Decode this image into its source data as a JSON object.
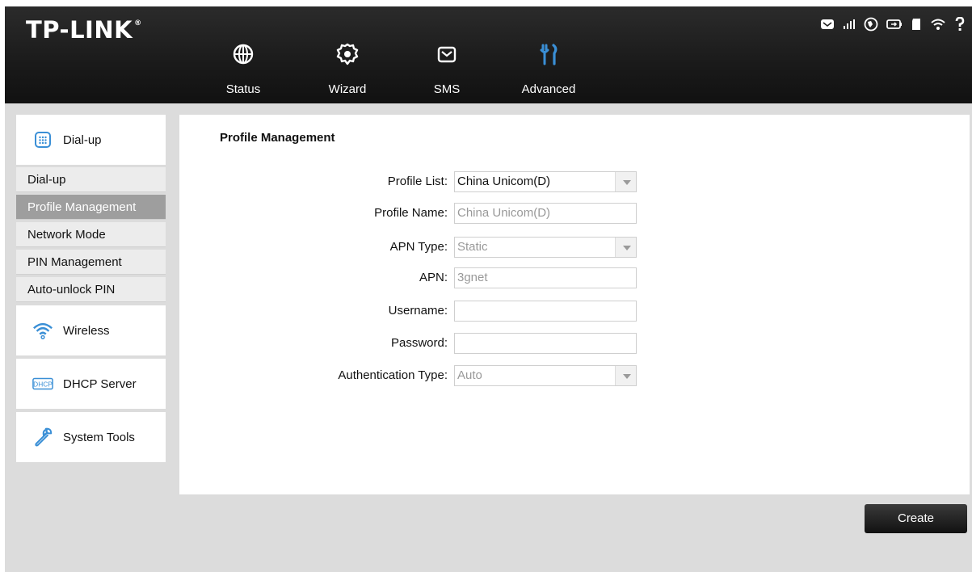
{
  "header": {
    "logo": "TP-LINK",
    "logo_mark": "®",
    "nav": [
      {
        "label": "Status",
        "icon": "globe-icon"
      },
      {
        "label": "Wizard",
        "icon": "gear-icon"
      },
      {
        "label": "SMS",
        "icon": "envelope-icon"
      },
      {
        "label": "Advanced",
        "icon": "tools-icon",
        "active": true
      }
    ],
    "status_icons": [
      "message-icon",
      "signal-icon",
      "internet-icon",
      "battery-icon",
      "sd-card-icon",
      "wifi-icon",
      "help-icon"
    ]
  },
  "sidebar": {
    "groups": [
      {
        "label": "Dial-up",
        "icon": "dialpad-icon",
        "items": [
          {
            "label": "Dial-up"
          },
          {
            "label": "Profile Management",
            "active": true
          },
          {
            "label": "Network Mode"
          },
          {
            "label": "PIN Management"
          },
          {
            "label": "Auto-unlock PIN"
          }
        ]
      },
      {
        "label": "Wireless",
        "icon": "wifi-icon"
      },
      {
        "label": "DHCP Server",
        "icon": "dhcp-icon",
        "icon_text": "DHCP"
      },
      {
        "label": "System Tools",
        "icon": "wrench-icon"
      }
    ]
  },
  "main": {
    "title": "Profile Management",
    "form": {
      "profile_list": {
        "label": "Profile List:",
        "value": "China Unicom(D)"
      },
      "profile_name": {
        "label": "Profile Name:",
        "value": "China Unicom(D)"
      },
      "apn_type": {
        "label": "APN Type:",
        "value": "Static"
      },
      "apn": {
        "label": "APN:",
        "value": "3gnet"
      },
      "username": {
        "label": "Username:",
        "value": ""
      },
      "password": {
        "label": "Password:",
        "value": ""
      },
      "auth_type": {
        "label": "Authentication Type:",
        "value": "Auto"
      }
    },
    "create_label": "Create"
  },
  "colors": {
    "header_bg": "#1a1a1a",
    "accent": "#3a8fd6",
    "page_bg": "#dcdcdc",
    "active_item_bg": "#9e9e9e"
  }
}
